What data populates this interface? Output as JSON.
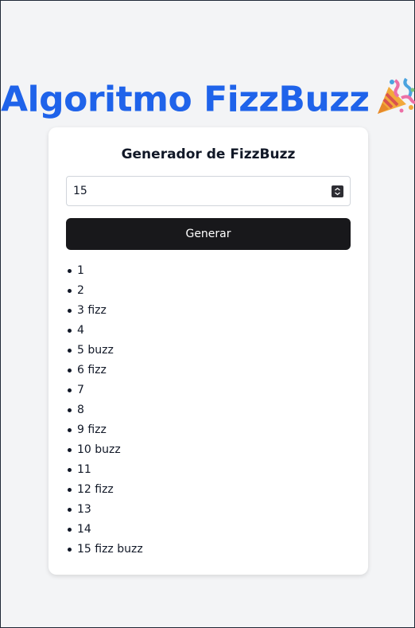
{
  "header": {
    "title": "Algoritmo FizzBuzz"
  },
  "card": {
    "title": "Generador de FizzBuzz",
    "input": {
      "value": "15"
    },
    "generate_label": "Generar",
    "results": [
      "1",
      "2",
      "3 fizz",
      "4",
      "5 buzz",
      "6 fizz",
      "7",
      "8",
      "9 fizz",
      "10 buzz",
      "11",
      "12 fizz",
      "13",
      "14",
      "15 fizz buzz"
    ]
  },
  "icons": {
    "title_icon": "party-popper-icon",
    "stepper_icon": "spin-stepper-icon"
  },
  "colors": {
    "title": "#1f63ea",
    "button_bg": "#18181b",
    "page_bg": "#f3f4f6",
    "card_bg": "#ffffff"
  }
}
